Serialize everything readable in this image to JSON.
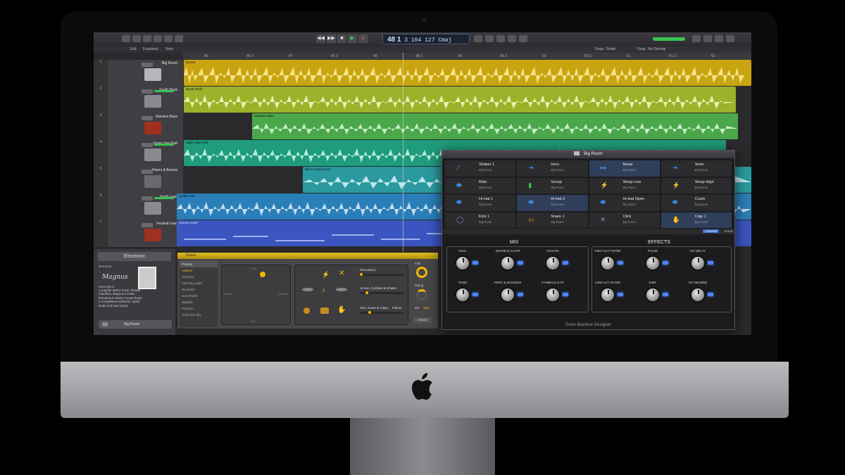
{
  "window": {
    "counter": "48 1",
    "counter_small": "3  104  127",
    "key": "Cmaj"
  },
  "menubar": {
    "edit": "Edit",
    "functions": "Functions",
    "view": "View",
    "snap_label": "Snap:",
    "snap_value": "Smart",
    "drag_label": "Drag:",
    "drag_value": "No Overlap"
  },
  "ruler": {
    "bars": [
      "46",
      "46.3",
      "47",
      "47.3",
      "48",
      "48.3",
      "49",
      "49.3",
      "50",
      "50.3",
      "51",
      "51.3",
      "52"
    ]
  },
  "tracks": [
    {
      "num": "1",
      "name": "Big Room",
      "region": "Drums",
      "color": "#c8a510"
    },
    {
      "num": "2",
      "name": "Synth Hook",
      "region": "Synth Hook",
      "color": "#9bb22a"
    },
    {
      "num": "3",
      "name": "Massive Bass",
      "region": "Massive Bass",
      "color": "#4aa84a"
    },
    {
      "num": "4",
      "name": "Super Saw Pad",
      "region": "Super Saw Pad",
      "color": "#1f9c7c"
    },
    {
      "num": "5",
      "name": "Risers & Booms",
      "region": "Risers & Boomers",
      "color": "#2a9aa0"
    },
    {
      "num": "6",
      "name": "Synth Lead",
      "region": "Synth Lead",
      "color": "#2b7fb8"
    },
    {
      "num": "7",
      "name": "Festival Lead",
      "region": "Gravity Synth",
      "color": "#3a55c0"
    }
  ],
  "library": {
    "header": "Electronic",
    "drummer_label": "Drummer",
    "signature": "Magnus",
    "description_label": "Description",
    "description": "A popular dance music festival headliner, Magnus creates thunderous electro house beats to compliment anthemic synth leads and bass drops.",
    "bottom_label": "Big Room"
  },
  "drummer_editor": {
    "title": "Drums",
    "presets_label": "Presets",
    "presets": [
      "Anthem",
      "Euphoria",
      "Flashing Lights",
      "Revelator",
      "Just Shuffle",
      "Nightlife",
      "Pinnacle",
      "Touch the Sky"
    ],
    "selected_preset": "Anthem",
    "percussion": "Percussion",
    "hihat": "Hi-Hat, Cymbals & Shaker",
    "kick": "Kick, Snare & Claps",
    "follow": "Follow",
    "fills": "Fills",
    "swing": "Swing",
    "swing_values": [
      "8th",
      "16th"
    ],
    "details": "Details",
    "xy_top": "Loud",
    "xy_bottom": "Soft",
    "xy_left": "Simple",
    "xy_right": "Complex"
  },
  "dmd": {
    "title": "Big Room",
    "pads": [
      {
        "name": "Shaker 1",
        "sub": "Big Room",
        "icon": "shaker-icon",
        "color": "#b37ad8"
      },
      {
        "name": "Horn",
        "sub": "Big Room",
        "icon": "horn-icon",
        "color": "#3a8de0"
      },
      {
        "name": "Noise",
        "sub": "Big Room",
        "icon": "noise-icon",
        "color": "#3a8de0"
      },
      {
        "name": "Siren",
        "sub": "Big Room",
        "icon": "siren-icon",
        "color": "#3a8de0"
      },
      {
        "name": "Ride",
        "sub": "Big Room",
        "icon": "ride-cymbal-icon",
        "color": "#3a8de0"
      },
      {
        "name": "Scoop",
        "sub": "Big Room",
        "icon": "scoop-icon",
        "color": "#3bc050"
      },
      {
        "name": "Sleep Low",
        "sub": "Big Room",
        "icon": "bolt-icon",
        "color": "#3a8de0"
      },
      {
        "name": "Sleep High",
        "sub": "Big Room",
        "icon": "bolt-icon",
        "color": "#3a8de0"
      },
      {
        "name": "Hi-Hat 1",
        "sub": "Big Room",
        "icon": "hihat-icon",
        "color": "#3a8de0"
      },
      {
        "name": "Hi-Hat 2",
        "sub": "Big Room",
        "icon": "hihat-icon",
        "color": "#3a8de0"
      },
      {
        "name": "Hi-Hat Open",
        "sub": "Big Room",
        "icon": "hihat-open-icon",
        "color": "#3a8de0"
      },
      {
        "name": "Crash",
        "sub": "Big Room",
        "icon": "crash-icon",
        "color": "#3a8de0"
      },
      {
        "name": "Kick 1",
        "sub": "Big Room",
        "icon": "kick-drum-icon",
        "color": "#b37ad8"
      },
      {
        "name": "Snare 1",
        "sub": "Big Room",
        "icon": "snare-icon",
        "color": "#e0a020"
      },
      {
        "name": "Click",
        "sub": "Big Room",
        "icon": "click-icon",
        "color": "#b37ad8"
      },
      {
        "name": "Clap 1",
        "sub": "Big Room",
        "icon": "clap-icon",
        "color": "#e0a020"
      }
    ],
    "tab_controls": "Controls",
    "tab_sends": "Sends",
    "mix_title": "MIX",
    "effects_title": "EFFECTS",
    "mix_knobs": [
      "KICK",
      "SNARE & CLAPS",
      "HI-HATS",
      "TOMS",
      "PERC & SHAKERS",
      "CYMBALS & FX"
    ],
    "fx_knobs": [
      "HIGH CUT FILTER",
      "PULSE",
      "KIT DELAY",
      "LOW CUT FILTER",
      "8-BIT",
      "KIT REVERB"
    ],
    "footer": "Drum Machine Designer"
  },
  "colors": {
    "accent_yellow": "#f5b800",
    "led_blue": "#4a86ff"
  }
}
